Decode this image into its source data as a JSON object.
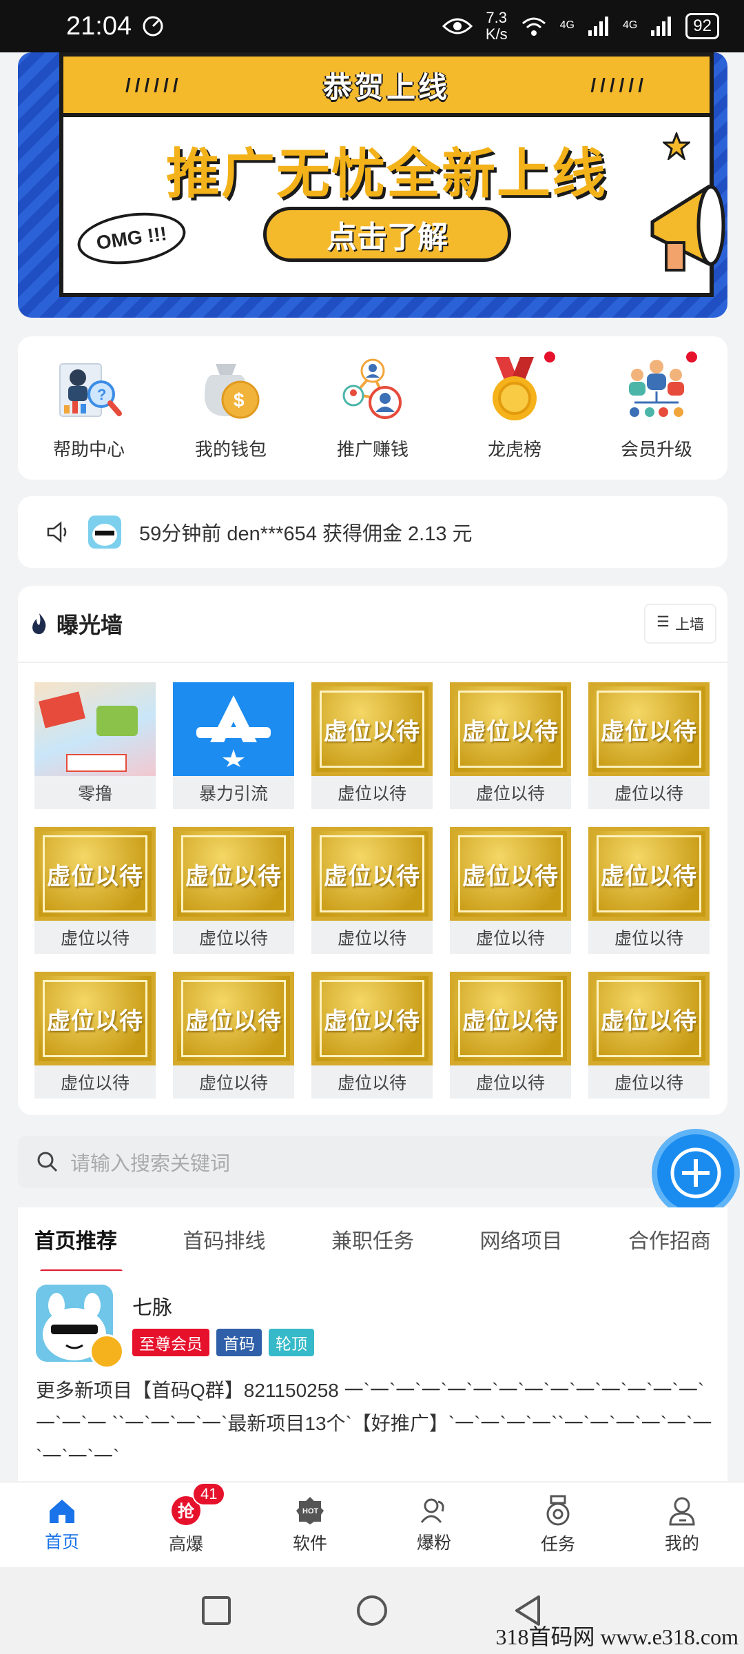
{
  "status_bar": {
    "time": "21:04",
    "speed_value": "7.3",
    "speed_unit": "K/s",
    "net1": "4G",
    "net2": "4G",
    "battery": "92"
  },
  "banner": {
    "top_title": "恭贺上线",
    "headline": "推广无忧全新上线",
    "button": "点击了解",
    "bubble": "OMG !!!"
  },
  "menu": [
    {
      "label": "帮助中心",
      "icon": "help-center-icon"
    },
    {
      "label": "我的钱包",
      "icon": "wallet-icon"
    },
    {
      "label": "推广赚钱",
      "icon": "promote-earn-icon"
    },
    {
      "label": "龙虎榜",
      "icon": "medal-ranking-icon"
    },
    {
      "label": "会员升级",
      "icon": "member-upgrade-icon"
    }
  ],
  "notice": {
    "text": "59分钟前 den***654 获得佣金 2.13 元"
  },
  "wall": {
    "title": "曝光墙",
    "button": "上墙",
    "tiles": [
      {
        "label": "零撸",
        "kind": "app"
      },
      {
        "label": "暴力引流",
        "kind": "app"
      },
      {
        "label": "虚位以待",
        "kind": "gold"
      },
      {
        "label": "虚位以待",
        "kind": "gold"
      },
      {
        "label": "虚位以待",
        "kind": "gold"
      },
      {
        "label": "虚位以待",
        "kind": "gold"
      },
      {
        "label": "虚位以待",
        "kind": "gold"
      },
      {
        "label": "虚位以待",
        "kind": "gold"
      },
      {
        "label": "虚位以待",
        "kind": "gold"
      },
      {
        "label": "虚位以待",
        "kind": "gold"
      },
      {
        "label": "虚位以待",
        "kind": "gold"
      },
      {
        "label": "虚位以待",
        "kind": "gold"
      },
      {
        "label": "虚位以待",
        "kind": "gold"
      },
      {
        "label": "虚位以待",
        "kind": "gold"
      },
      {
        "label": "虚位以待",
        "kind": "gold"
      }
    ],
    "gold_text": "虚位以待"
  },
  "search": {
    "placeholder": "请输入搜索关键词"
  },
  "tabs": [
    "首页推荐",
    "首码排线",
    "兼职任务",
    "网络项目",
    "合作招商"
  ],
  "post": {
    "user": "七脉",
    "badges": [
      {
        "text": "至尊会员",
        "color": "#e6112b"
      },
      {
        "text": "首码",
        "color": "#2f5fa8"
      },
      {
        "text": "轮顶",
        "color": "#36b9c8"
      }
    ],
    "text": "更多新项目【首码Q群】821150258 一`一`一`一`一`一`一`一`一`一`一`一`一`一`一`一`一 ``一`一`一`一`最新项目13个`【好推广】`一`一`一`一``一`一`一`一`一`一`一`一`一`"
  },
  "bottom_nav": [
    {
      "label": "首页",
      "icon": "home-icon"
    },
    {
      "label": "高爆",
      "icon": "grab-icon",
      "badge": "41"
    },
    {
      "label": "软件",
      "icon": "hot-software-icon"
    },
    {
      "label": "爆粉",
      "icon": "fans-icon"
    },
    {
      "label": "任务",
      "icon": "task-medal-icon"
    },
    {
      "label": "我的",
      "icon": "profile-icon"
    }
  ],
  "watermark": "318首码网 www.e318.com",
  "colors": {
    "accent": "#1a73e8",
    "red": "#e0172e",
    "gold": "#f5b92c"
  }
}
